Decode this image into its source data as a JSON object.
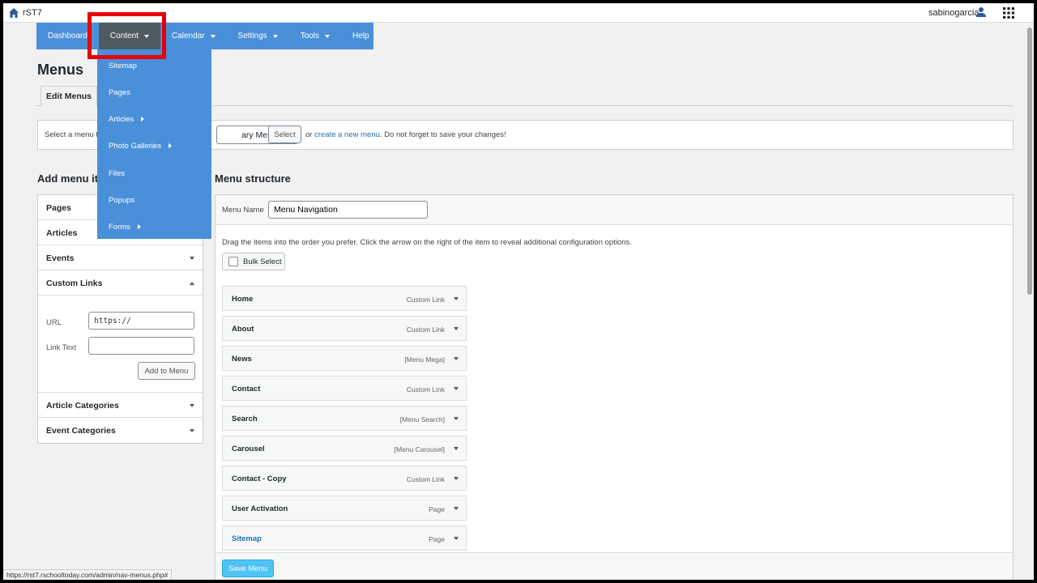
{
  "topbar": {
    "site_name": "rST7",
    "username": "sabinogarcia",
    "icons": [
      "home-icon",
      "user-icon",
      "apps-grid-icon"
    ]
  },
  "nav": {
    "items": [
      {
        "label": "Dashboard",
        "has_dropdown": false,
        "active": false
      },
      {
        "label": "Content",
        "has_dropdown": true,
        "active": true
      },
      {
        "label": "Calendar",
        "has_dropdown": true,
        "active": false
      },
      {
        "label": "Settings",
        "has_dropdown": true,
        "active": false
      },
      {
        "label": "Tools",
        "has_dropdown": true,
        "active": false
      },
      {
        "label": "Help",
        "has_dropdown": false,
        "active": false
      }
    ],
    "content_dropdown": [
      {
        "label": "Sitemap",
        "submenu": false
      },
      {
        "label": "Pages",
        "submenu": false
      },
      {
        "label": "Articles",
        "submenu": true
      },
      {
        "label": "Photo Galleries",
        "submenu": true
      },
      {
        "label": "Files",
        "submenu": false
      },
      {
        "label": "Popups",
        "submenu": false
      },
      {
        "label": "Forms",
        "submenu": true
      }
    ]
  },
  "page": {
    "title": "Menus",
    "tab": "Edit Menus"
  },
  "select_menu": {
    "prefix": "Select a menu to",
    "selected": "ary Menu)",
    "button": "Select",
    "or_text": "or",
    "create_link": "create a new menu",
    "suffix": ". Do not forget to save your changes!"
  },
  "add_items": {
    "heading": "Add menu ite",
    "sections_top": [
      {
        "label": "Pages",
        "arrow": "down"
      },
      {
        "label": "Articles",
        "arrow": "down"
      },
      {
        "label": "Events",
        "arrow": "down"
      },
      {
        "label": "Custom Links",
        "arrow": "up"
      }
    ],
    "custom_links": {
      "url_label": "URL",
      "url_value": "https://",
      "link_text_label": "Link Text",
      "link_text_value": "",
      "add_button": "Add to Menu"
    },
    "sections_bottom": [
      {
        "label": "Article Categories",
        "arrow": "down"
      },
      {
        "label": "Event Categories",
        "arrow": "down"
      }
    ]
  },
  "structure": {
    "heading": "Menu structure",
    "name_label": "Menu Name",
    "name_value": "Menu Navigation",
    "instructions": "Drag the items into the order you prefer. Click the arrow on the right of the item to reveal additional configuration options.",
    "bulk_select": "Bulk Select",
    "items": [
      {
        "title": "Home",
        "type": "Custom Link",
        "link": false
      },
      {
        "title": "About",
        "type": "Custom Link",
        "link": false
      },
      {
        "title": "News",
        "type": "[Menu Mega]",
        "link": false
      },
      {
        "title": "Contact",
        "type": "Custom Link",
        "link": false
      },
      {
        "title": "Search",
        "type": "[Menu Search]",
        "link": false
      },
      {
        "title": "Carousel",
        "type": "[Menu Carousel]",
        "link": false
      },
      {
        "title": "Contact - Copy",
        "type": "Custom Link",
        "link": false
      },
      {
        "title": "User Activation",
        "type": "Page",
        "link": false
      },
      {
        "title": "Sitemap",
        "type": "Page",
        "link": true
      }
    ],
    "save_button": "Save Menu"
  },
  "statusbar": {
    "url": "https://rst7.rschooltoday.com/admin/nav-menus.php#"
  },
  "colors": {
    "nav_bg": "#4a90d9",
    "nav_active": "#4f5a63",
    "highlight": "#e8000b",
    "save_button": "#4fc3f7",
    "link": "#2271b1"
  }
}
